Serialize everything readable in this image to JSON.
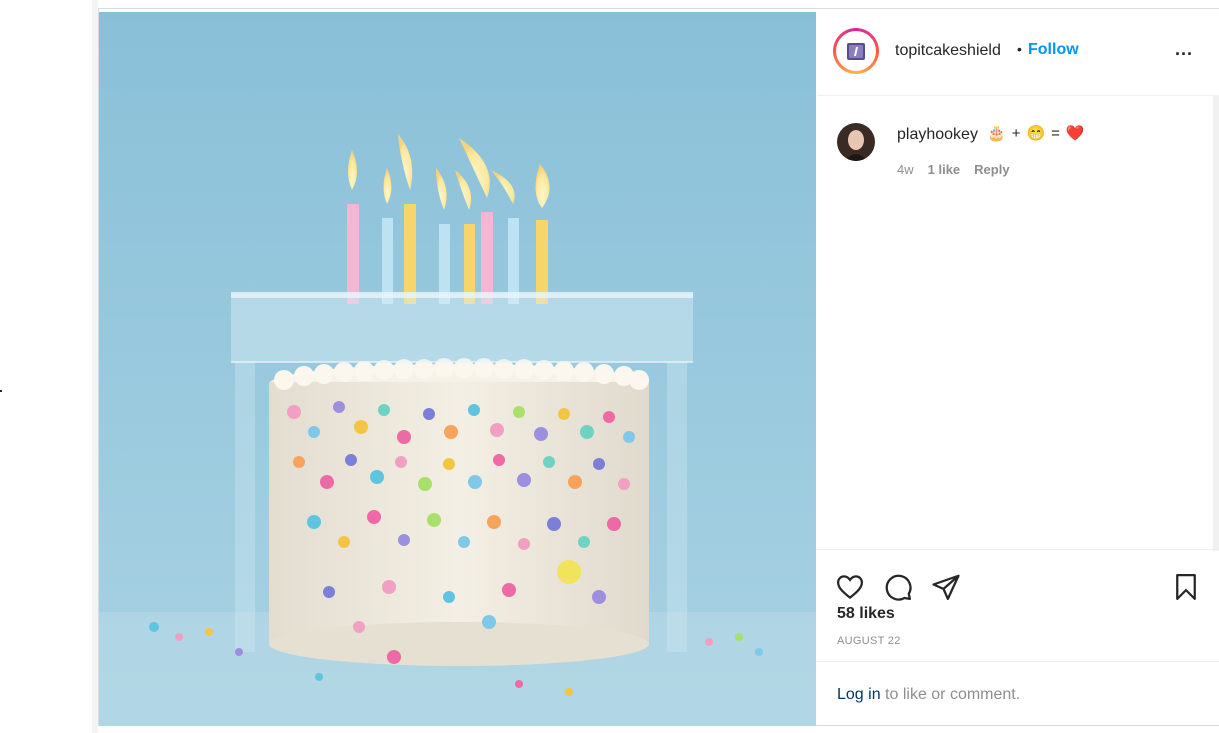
{
  "post": {
    "author": {
      "username": "topitcakeshield",
      "follow_label": "Follow",
      "separator": "•",
      "more_label": "..."
    },
    "comments": [
      {
        "username": "playhookey",
        "text_parts": [
          "🎂",
          "+",
          "😁",
          "=",
          "❤️"
        ],
        "age": "4w",
        "likes": "1 like",
        "reply_label": "Reply"
      }
    ],
    "likes_count": "58 likes",
    "date": "AUGUST 22",
    "login_link": "Log in",
    "login_rest": " to like or comment."
  },
  "icons": [
    "ellipsis-icon",
    "heart-icon",
    "comment-icon",
    "share-icon",
    "bookmark-icon"
  ],
  "colors": {
    "accent": "#0095f6",
    "link": "#00376b",
    "muted": "#8e8e8e",
    "background": "#8ec3d9"
  }
}
